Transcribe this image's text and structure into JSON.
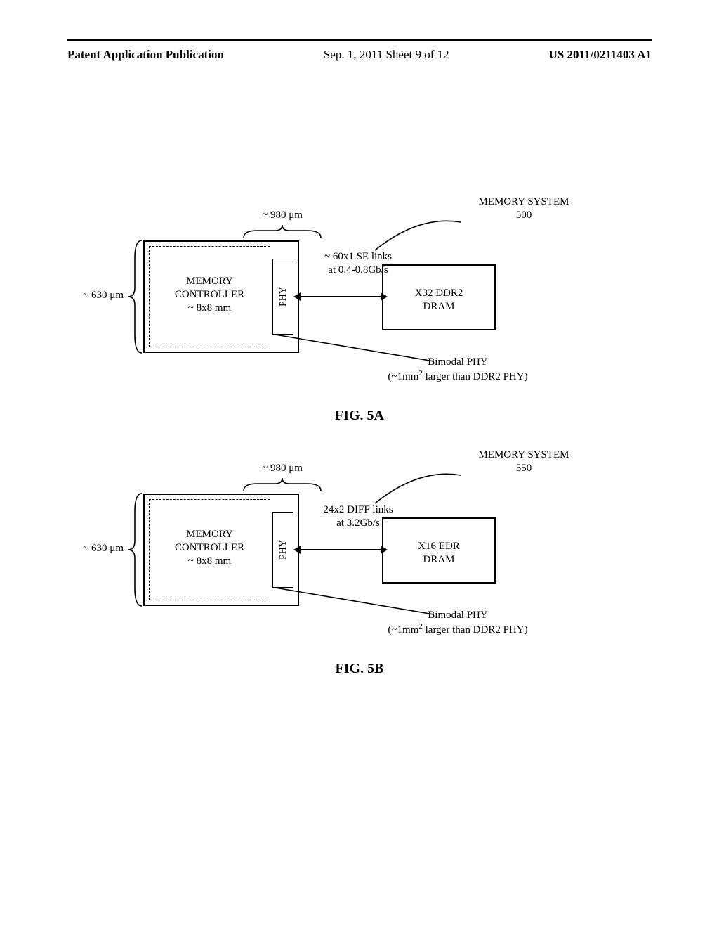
{
  "header": {
    "left": "Patent Application Publication",
    "center": "Sep. 1, 2011   Sheet 9 of 12",
    "right": "US 2011/0211403 A1"
  },
  "figA": {
    "caption": "FIG. 5A",
    "system_label_line1": "MEMORY SYSTEM",
    "system_label_line2": "500",
    "width_label": "~ 980 μm",
    "height_label": "~ 630 μm",
    "mem_controller_line1": "MEMORY",
    "mem_controller_line2": "CONTROLLER",
    "mem_controller_line3": "~ 8x8 mm",
    "phy_label": "PHY",
    "link_line1": "~ 60x1 SE links",
    "link_line2": "at 0.4-0.8Gb/s",
    "dram_line1": "X32 DDR2",
    "dram_line2": "DRAM",
    "phy_note_line1": "Bimodal PHY",
    "phy_note_line2_a": "(~1mm",
    "phy_note_line2_b": " larger than DDR2 PHY)"
  },
  "figB": {
    "caption": "FIG. 5B",
    "system_label_line1": "MEMORY SYSTEM",
    "system_label_line2": "550",
    "width_label": "~ 980 μm",
    "height_label": "~ 630 μm",
    "mem_controller_line1": "MEMORY",
    "mem_controller_line2": "CONTROLLER",
    "mem_controller_line3": "~ 8x8 mm",
    "phy_label": "PHY",
    "link_line1": "24x2 DIFF links",
    "link_line2": "at 3.2Gb/s",
    "dram_line1": "X16 EDR",
    "dram_line2": "DRAM",
    "phy_note_line1": "Bimodal PHY",
    "phy_note_line2_a": "(~1mm",
    "phy_note_line2_b": " larger than DDR2 PHY)"
  },
  "chart_data": [
    {
      "type": "diagram",
      "figure": "5A",
      "title": "MEMORY SYSTEM 500",
      "controller": {
        "label": "MEMORY CONTROLLER",
        "die_size": "~ 8x8 mm"
      },
      "phy": {
        "label": "PHY",
        "width_um": 980,
        "height_um": 630,
        "note": "Bimodal PHY (~1mm^2 larger than DDR2 PHY)"
      },
      "link": {
        "count": "~60x1",
        "type": "SE",
        "rate_Gbps": "0.4-0.8"
      },
      "dram": {
        "type": "X32 DDR2 DRAM"
      }
    },
    {
      "type": "diagram",
      "figure": "5B",
      "title": "MEMORY SYSTEM 550",
      "controller": {
        "label": "MEMORY CONTROLLER",
        "die_size": "~ 8x8 mm"
      },
      "phy": {
        "label": "PHY",
        "width_um": 980,
        "height_um": 630,
        "note": "Bimodal PHY (~1mm^2 larger than DDR2 PHY)"
      },
      "link": {
        "count": "24x2",
        "type": "DIFF",
        "rate_Gbps": "3.2"
      },
      "dram": {
        "type": "X16 EDR DRAM"
      }
    }
  ]
}
